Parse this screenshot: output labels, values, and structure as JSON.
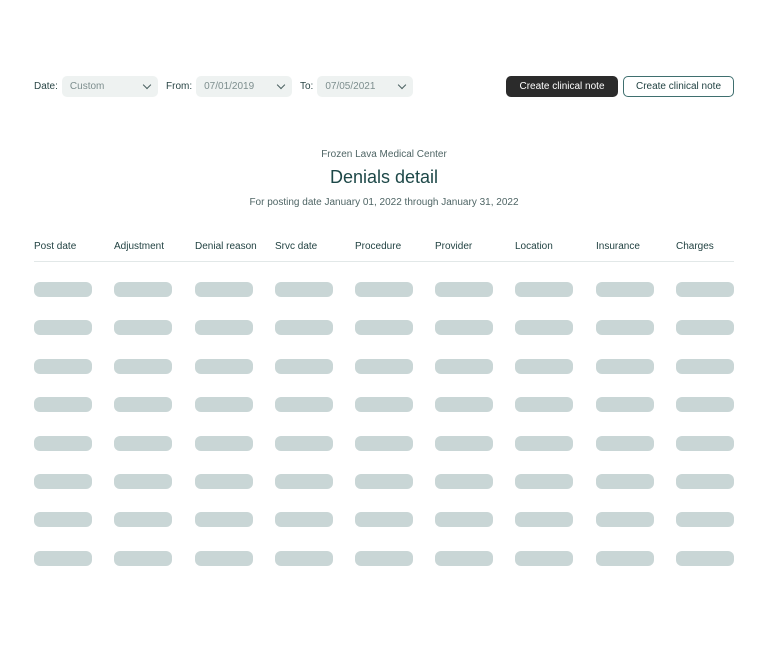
{
  "filters": {
    "date": {
      "label": "Date:",
      "value": "Custom"
    },
    "from": {
      "label": "From:",
      "value": "07/01/2019"
    },
    "to": {
      "label": "To:",
      "value": "07/05/2021"
    }
  },
  "buttons": {
    "primary": "Create clinical note",
    "secondary": "Create clinical note"
  },
  "report": {
    "organization": "Frozen Lava Medical Center",
    "title": "Denials detail",
    "subtitle": "For posting date January 01, 2022 through January 31, 2022"
  },
  "table": {
    "columns": [
      "Post date",
      "Adjustment",
      "Denial reason",
      "Srvc date",
      "Procedure",
      "Provider",
      "Location",
      "Insurance",
      "Charges"
    ],
    "loading_rows": 8
  }
}
